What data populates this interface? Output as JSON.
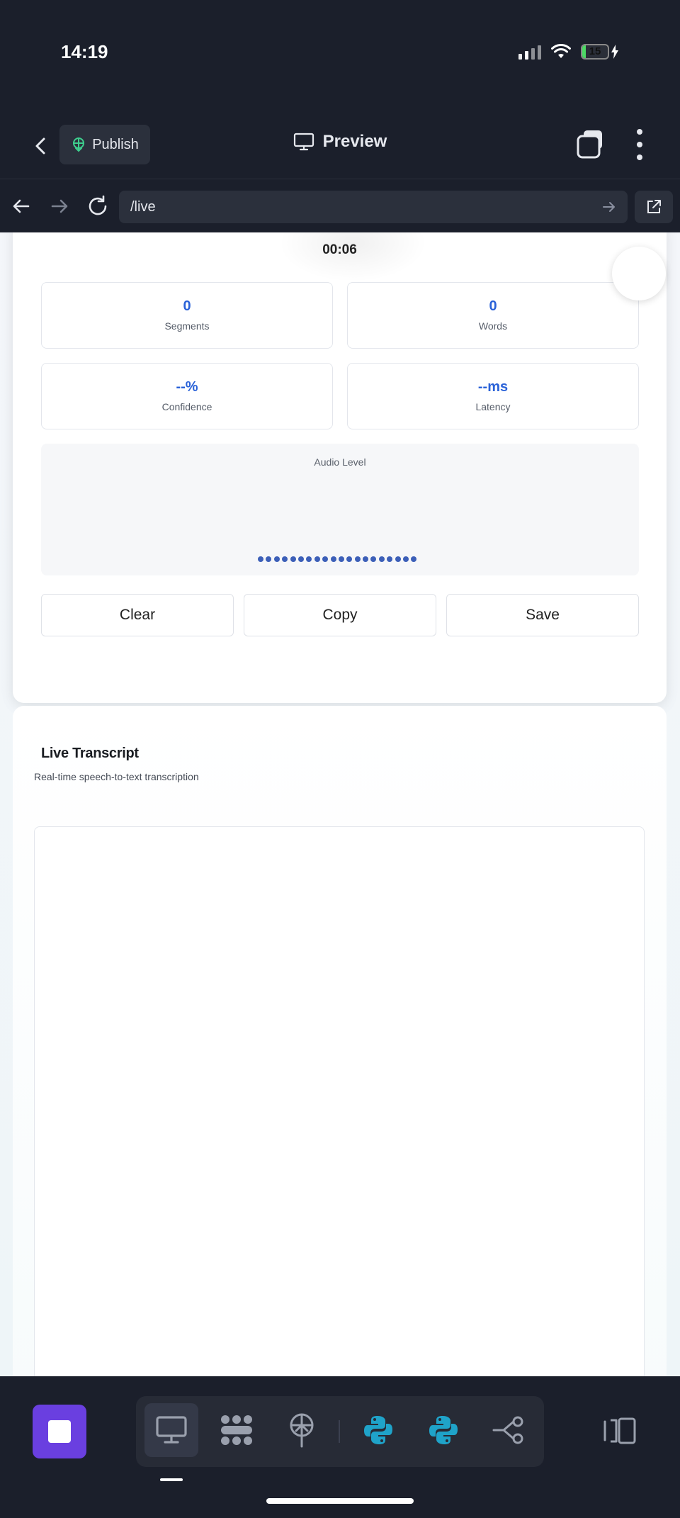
{
  "status_bar": {
    "time": "14:19",
    "battery": "15"
  },
  "toolbar": {
    "publish_label": "Publish",
    "preview_label": "Preview"
  },
  "url_bar": {
    "url": "/live"
  },
  "recorder": {
    "timer": "00:06",
    "stats": [
      {
        "value": "0",
        "label": "Segments"
      },
      {
        "value": "0",
        "label": "Words"
      },
      {
        "value": "--%",
        "label": "Confidence"
      },
      {
        "value": "--ms",
        "label": "Latency"
      }
    ],
    "audio_level_title": "Audio Level",
    "audio_level_dot_count": 20,
    "buttons": {
      "clear": "Clear",
      "copy": "Copy",
      "save": "Save"
    }
  },
  "transcript": {
    "title": "Live Transcript",
    "subtitle": "Real-time speech-to-text transcription",
    "text": ""
  },
  "colors": {
    "accent": "#2a62d8",
    "stop_button": "#6a3fe0",
    "audio_dot": "#3c5fb8",
    "python_icon": "#1fa3c9",
    "chrome_bg": "#1b1f2b"
  },
  "bottom_toolbar": {
    "tools": [
      "monitor-icon",
      "blocks-icon",
      "antenna-icon",
      "python-icon",
      "python-icon",
      "workflow-icon"
    ]
  }
}
